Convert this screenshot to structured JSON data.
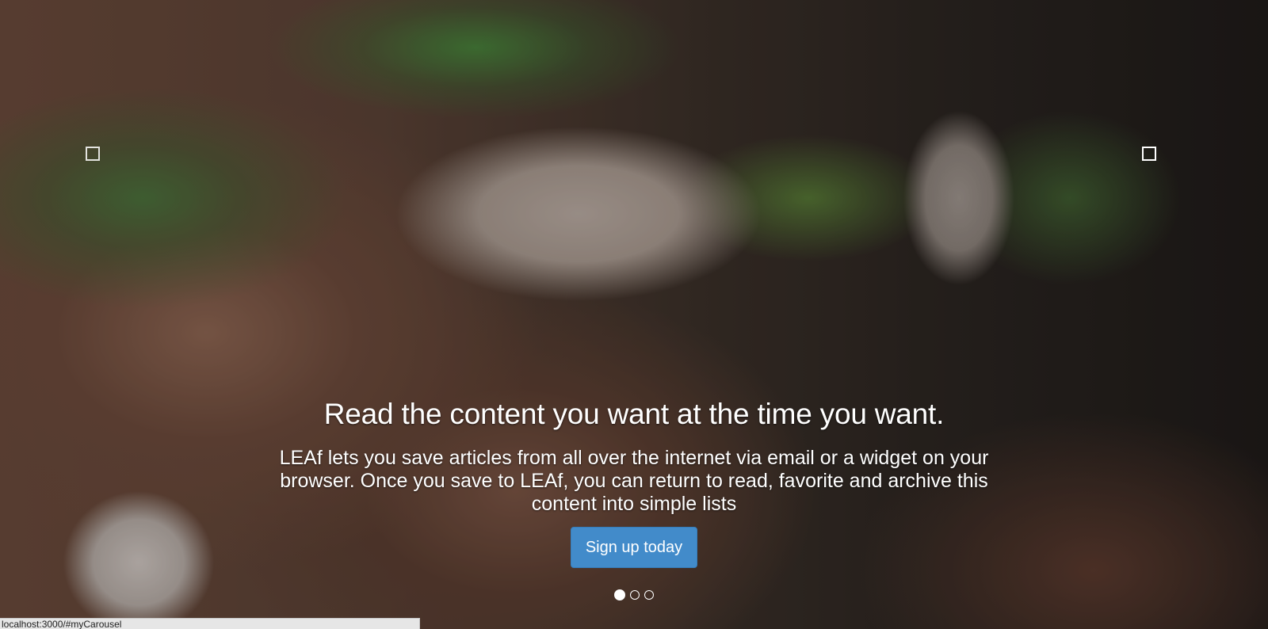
{
  "carousel": {
    "heading": "Read the content you want at the time you want.",
    "text": "LEAf lets you save articles from all over the internet via email or a widget on your browser. Once you save to LEAf, you can return to read, favorite and archive this content into simple lists",
    "button_label": "Sign up today",
    "indicators": {
      "count": 3,
      "active": 1
    },
    "prev_icon": "square-outline-icon",
    "next_icon": "square-outline-icon",
    "button_color": "#428bca"
  },
  "statusbar": {
    "url": "localhost:3000/#myCarousel"
  }
}
